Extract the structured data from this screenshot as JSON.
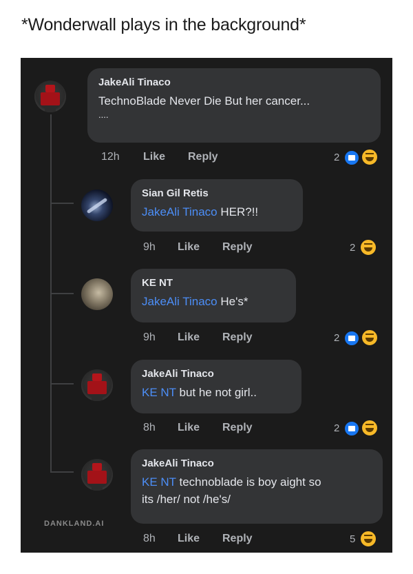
{
  "caption": "*Wonderwall plays in the background*",
  "watermark": "DANKLAND.AI",
  "comments": [
    {
      "author": "JakeAli Tinaco",
      "mention": "",
      "text": "TechnoBlade Never Die But her cancer...",
      "text2": "....",
      "time": "12h",
      "like": "Like",
      "reply": "Reply",
      "reactions": "2",
      "reaction_icons": [
        "like-icon",
        "haha-icon"
      ]
    },
    {
      "author": "Sian Gil Retis",
      "mention": "JakeAli Tinaco",
      "text": "HER?!!",
      "time": "9h",
      "like": "Like",
      "reply": "Reply",
      "reactions": "2",
      "reaction_icons": [
        "haha-icon"
      ]
    },
    {
      "author": "KE NT",
      "mention": "JakeAli Tinaco",
      "text": "He's*",
      "time": "9h",
      "like": "Like",
      "reply": "Reply",
      "reactions": "2",
      "reaction_icons": [
        "like-icon",
        "haha-icon"
      ]
    },
    {
      "author": "JakeAli Tinaco",
      "mention": "KE NT",
      "text": "but he not girl..",
      "time": "8h",
      "like": "Like",
      "reply": "Reply",
      "reactions": "2",
      "reaction_icons": [
        "like-icon",
        "haha-icon"
      ]
    },
    {
      "author": "JakeAli Tinaco",
      "mention": "KE NT",
      "text": "technoblade is boy aight so",
      "text2": "its /her/ not /he's/",
      "time": "8h",
      "like": "Like",
      "reply": "Reply",
      "reactions": "5",
      "reaction_icons": [
        "haha-icon"
      ]
    }
  ],
  "colors": {
    "panel_bg": "#1b1b1b",
    "bubble_bg": "#333436",
    "mention": "#4c8ef7",
    "like_blue": "#1877f2",
    "haha_yellow": "#f7b928"
  }
}
